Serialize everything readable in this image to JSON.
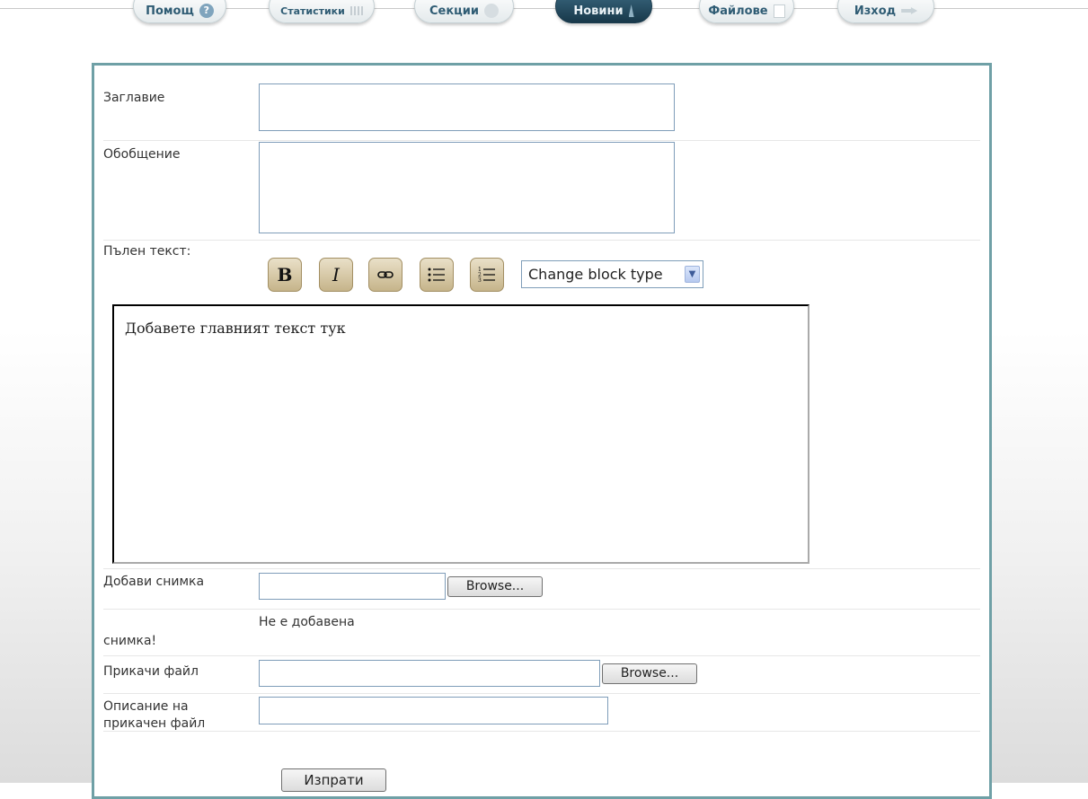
{
  "nav": {
    "tabs": [
      {
        "label": "Помощ",
        "icon": "help-icon"
      },
      {
        "label": "Статистики",
        "icon": "stats-icon"
      },
      {
        "label": "Секции",
        "icon": "sections-icon"
      },
      {
        "label": "Новини",
        "icon": "news-icon",
        "active": true
      },
      {
        "label": "Файлове",
        "icon": "files-icon"
      },
      {
        "label": "Изход",
        "icon": "exit-icon"
      }
    ]
  },
  "form": {
    "title_label": "Заглавие",
    "title_value": "",
    "summary_label": "Обобщение",
    "summary_value": "",
    "fulltext_label": "Пълен текст:",
    "toolbar": {
      "bold": "B",
      "italic": "I",
      "block_type": "Change block type"
    },
    "editor_text": "Добавете главният текст тук",
    "image_label": "Добави снимка",
    "image_browse": "Browse...",
    "no_image_line1": "Не е добавена",
    "no_image_line2": "снимка!",
    "attach_label": "Прикачи файл",
    "attach_browse": "Browse...",
    "attach_desc_label_1": "Описание на",
    "attach_desc_label_2": "прикачен файл",
    "submit": "Изпрати"
  },
  "colors": {
    "panel_border": "#6fa0a6",
    "active_tab": "#1f4458",
    "toolbar_button": "#d6c8a2"
  }
}
